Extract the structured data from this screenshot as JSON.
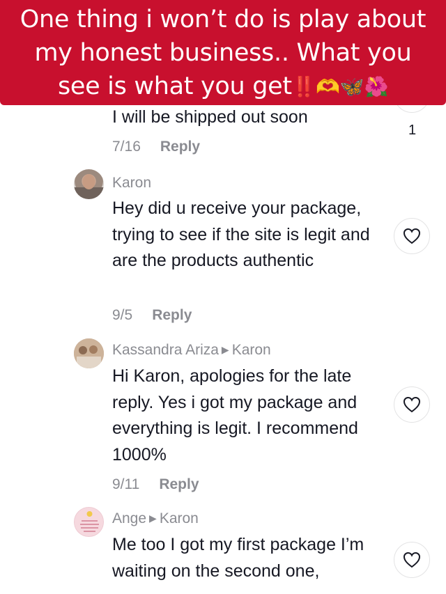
{
  "banner": {
    "line1": "One thing i won’t do is play about",
    "line2": "my honest business.. What you",
    "line3": "see is what you get",
    "emojis": "‼️🫶🦋🌺"
  },
  "comments": [
    {
      "body": "I will be shipped out soon",
      "date": "7/16",
      "reply_label": "Reply",
      "like_count": "1"
    },
    {
      "author": "Karon",
      "body": "Hey did u receive your package, trying to see if the site is legit and are the products authentic",
      "date": "9/5",
      "reply_label": "Reply"
    },
    {
      "author": "Kassandra Ariza",
      "reply_to": "Karon",
      "body": "Hi Karon, apologies for the late reply. Yes i got my package and everything is legit. I recommend 1000%",
      "date": "9/11",
      "reply_label": "Reply"
    },
    {
      "author": "Ange",
      "reply_to": "Karon",
      "body": "Me too I got my first package I’m waiting on the second one,",
      "avatar_text": "today is a good day to look and be happy"
    }
  ],
  "colors": {
    "banner": "#c8102e",
    "text": "#161823",
    "muted": "#8a8b91"
  }
}
